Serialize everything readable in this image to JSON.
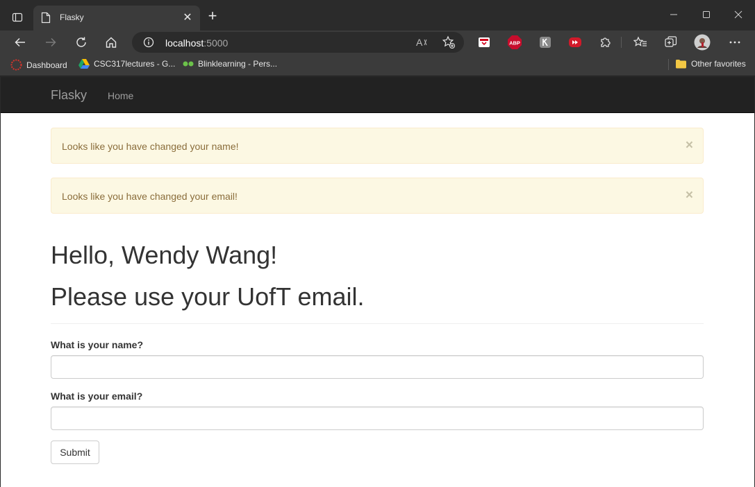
{
  "browser": {
    "tab_title": "Flasky",
    "new_tab_symbol": "+",
    "close_symbol": "✕",
    "address": {
      "host": "localhost",
      "port": ":5000"
    },
    "extensions": [
      "pocket-icon",
      "adblock-plus-icon",
      "extension-k-icon",
      "extension-red-icon",
      "extensions-puzzle-icon"
    ],
    "adblock_label": "ABP",
    "bookmarks": [
      {
        "label": "Dashboard",
        "icon": "dashboard-icon"
      },
      {
        "label": "CSC317lectures - G...",
        "icon": "google-drive-icon"
      },
      {
        "label": "Blinklearning - Pers...",
        "icon": "blinklearning-icon"
      }
    ],
    "other_favorites": "Other favorites"
  },
  "navbar": {
    "brand": "Flasky",
    "links": [
      "Home"
    ]
  },
  "alerts": [
    {
      "text": "Looks like you have changed your name!",
      "close": "×"
    },
    {
      "text": "Looks like you have changed your email!",
      "close": "×"
    }
  ],
  "main": {
    "greeting": "Hello, Wendy Wang!",
    "subheading": "Please use your UofT email."
  },
  "form": {
    "name_label": "What is your name?",
    "name_value": "",
    "email_label": "What is your email?",
    "email_value": "",
    "submit_label": "Submit"
  },
  "colors": {
    "navbar_bg": "#222222",
    "alert_bg": "#fcf8e3",
    "alert_text": "#8a6d3b",
    "chrome_bg": "#2b2b2b"
  }
}
